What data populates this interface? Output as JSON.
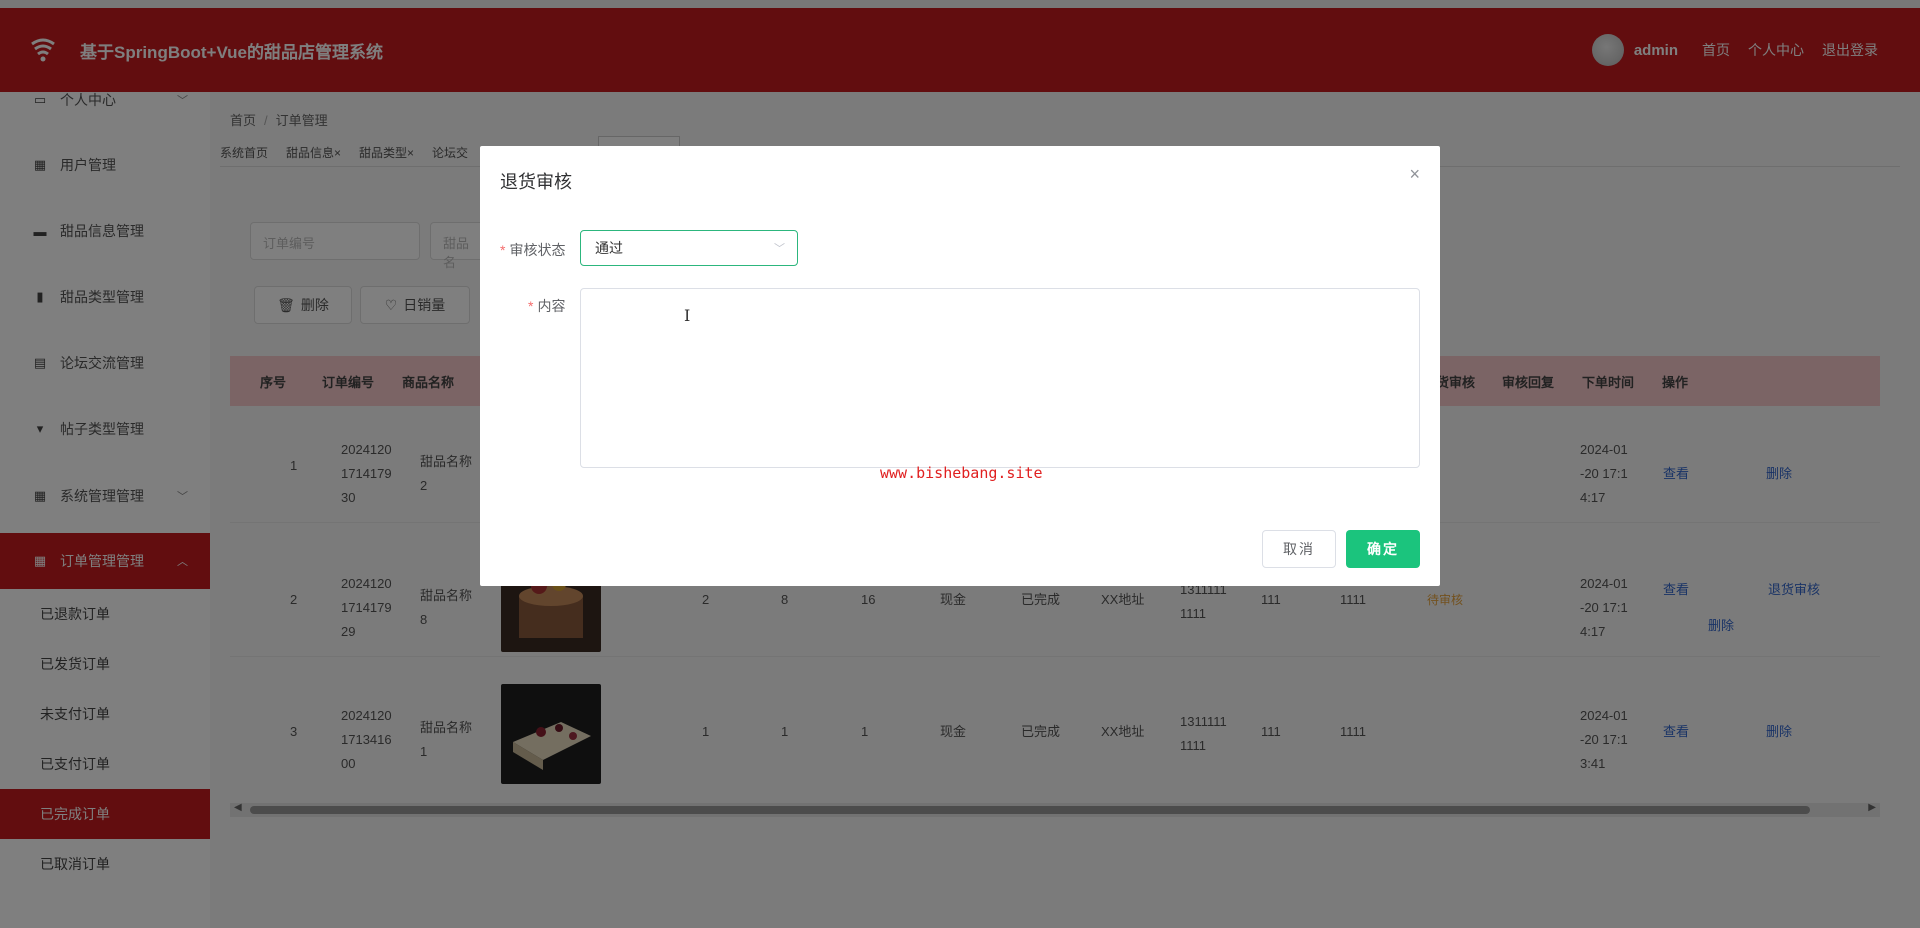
{
  "header": {
    "title": "基于SpringBoot+Vue的甜品店管理系统",
    "username": "admin",
    "links": [
      "首页",
      "个人中心",
      "退出登录"
    ]
  },
  "sidebar": {
    "items": [
      {
        "label": "个人中心",
        "icon": "calendar-icon",
        "has_arrow": true
      },
      {
        "label": "用户管理",
        "icon": "grid-icon"
      },
      {
        "label": "甜品信息管理",
        "icon": "briefcase-icon"
      },
      {
        "label": "甜品类型管理",
        "icon": "bar-chart-icon"
      },
      {
        "label": "论坛交流管理",
        "icon": "clipboard-icon"
      },
      {
        "label": "帖子类型管理",
        "icon": "pin-icon"
      },
      {
        "label": "系统管理管理",
        "icon": "grid-icon",
        "has_arrow": true
      },
      {
        "label": "订单管理管理",
        "icon": "grid-icon",
        "has_arrow": true,
        "active": true
      }
    ],
    "sub_items": [
      "已退款订单",
      "已发货订单",
      "未支付订单",
      "已支付订单",
      "已完成订单",
      "已取消订单"
    ],
    "active_sub": "已完成订单"
  },
  "breadcrumb": [
    "首页",
    "订单管理"
  ],
  "tags": [
    "系统首页",
    "甜品信息×",
    "甜品类型×",
    "论坛交"
  ],
  "search": {
    "order_no_placeholder": "订单编号",
    "name_placeholder": "甜品名"
  },
  "toolbar": {
    "delete_label": "删除",
    "sales_label": "日销量"
  },
  "table": {
    "headers": [
      "序号",
      "订单编号",
      "商品名称",
      "货审核",
      "审核回复",
      "下单时间",
      "操作"
    ],
    "rows": [
      {
        "index": "1",
        "order_no": [
          "2024120",
          "1714179",
          "30"
        ],
        "name": [
          "甜品名称",
          "2"
        ],
        "time": [
          "2024-01",
          "-20 17:1",
          "4:17"
        ],
        "actions": [
          "查看",
          "删除"
        ]
      },
      {
        "index": "2",
        "order_no": [
          "2024120",
          "1714179",
          "29"
        ],
        "name": [
          "甜品名称",
          "8"
        ],
        "qty": "2",
        "price": "8",
        "total": "16",
        "pay": "现金",
        "status": "已完成",
        "addr": "XX地址",
        "phone": [
          "1311111",
          "1111"
        ],
        "c1": "111",
        "c2": "1111",
        "audit": "待审核",
        "time": [
          "2024-01",
          "-20 17:1",
          "4:17"
        ],
        "actions": [
          "查看",
          "退货审核",
          "删除"
        ]
      },
      {
        "index": "3",
        "order_no": [
          "2024120",
          "1713416",
          "00"
        ],
        "name": [
          "甜品名称",
          "1"
        ],
        "qty": "1",
        "price": "1",
        "total": "1",
        "pay": "现金",
        "status": "已完成",
        "addr": "XX地址",
        "phone": [
          "1311111",
          "1111"
        ],
        "c1": "111",
        "c2": "1111",
        "time": [
          "2024-01",
          "-20 17:1",
          "3:41"
        ],
        "actions": [
          "查看",
          "删除"
        ]
      }
    ]
  },
  "dialog": {
    "title": "退货审核",
    "status_label": "审核状态",
    "status_value": "通过",
    "content_label": "内容",
    "watermark": "www.bishebang.site",
    "cancel_label": "取消",
    "confirm_label": "确定"
  },
  "colors": {
    "brand": "#c41a1e",
    "confirm": "#1bc47d",
    "header_row": "#f6c9ca"
  }
}
